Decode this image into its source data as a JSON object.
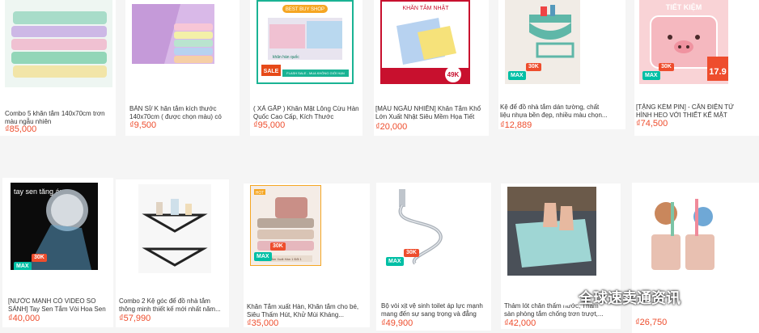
{
  "products": [
    {
      "title": "Combo 5 khăn tắm 140x70cm trơn màu ngẫu nhiên",
      "price": "₫85,000"
    },
    {
      "title": "BÁN SỈ/ K hăn tắm kích thước 140x70cm ( được chọn màu) có ảnh...",
      "price": "₫9,500"
    },
    {
      "title": "( XẢ GẤP ) Khăn Mặt Lông Cừu Hàn Quốc Cao Cấp, Kích Thước 30x50cm",
      "price": "₫95,000"
    },
    {
      "title": "[MÀU NGẪU NHIÊN] Khăn Tắm Khổ Lớn Xuất Nhật Siêu Mềm Họa Tiết In...",
      "price": "₫20,000"
    },
    {
      "title": "Kệ để đồ nhà tắm dán tường, chất liệu nhựa bền đẹp, nhiều màu chọn...",
      "price": "₫12,889"
    },
    {
      "title": "[TẶNG KÈM PIN] - CÂN ĐIỆN TỬ HÌNH HEO VỚI THIẾT KẾ MẶT KÍNH...",
      "price": "₫74,500"
    },
    {
      "title": "[NƯỚC MẠNH CÓ VIDEO SO SÁNH] Tay Sen Tắm Vòi Hoa Sen TĂNG ÁP...",
      "price": "₫40,000"
    },
    {
      "title": "Combo 2 Kệ góc để đồ nhà tắm thông minh thiết kế mới nhất năm...",
      "price": "₫57,990"
    },
    {
      "title": "Khăn Tắm xuất Hàn, Khăn tắm cho bé, Siêu Thấm Hút, Khử Mùi Kháng...",
      "price": "₫35,000"
    },
    {
      "title": "Bộ vòi xịt vệ sinh toilet áp lực mạnh mang đến sự sang trọng và đẳng cấ...",
      "price": "₫49,900"
    },
    {
      "title": "Thảm lót chân thấm nước, Thảm sàn phòng tắm chống trơn trượt,...",
      "price": "₫42,000"
    },
    {
      "title": "",
      "price": "₫26,750"
    }
  ],
  "overlays": {
    "towel_shop_label": "KHĂN TẮM NHẬT",
    "best_buy_shop": "BEST BUY SHOP",
    "han_quoc": "khăn hàn quốc",
    "sale": "SALE",
    "flash_sale": "FLASH SALE - MUA KHÔNG GIỚI HẠN",
    "giam": "49K",
    "scale_price": "17.9",
    "scale_top": "TIẾT KIỆM",
    "shower_label": "tay sen tăng áp",
    "max_label": "MAX",
    "k30": "30K",
    "hot": "HOT",
    "towel_sub": "Tắm Xuất Hàn 1 Đổi 1"
  },
  "watermark": {
    "text": "全球速卖通资讯"
  },
  "colors": {
    "price": "#ee4d2d",
    "max_badge": "#00bfa5"
  }
}
